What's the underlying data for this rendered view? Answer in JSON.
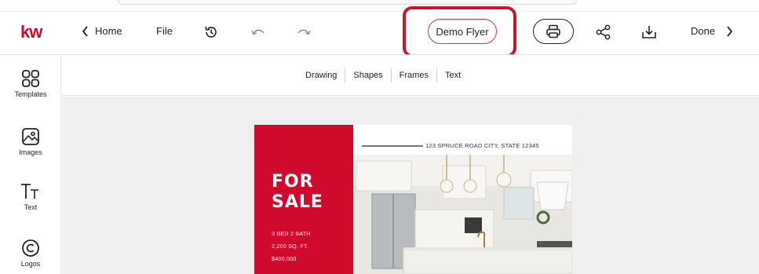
{
  "app": {
    "logo_text": "kw"
  },
  "toolbar": {
    "home_label": "Home",
    "file_label": "File",
    "document_name": "Demo Flyer",
    "done_label": "Done"
  },
  "subtabs": [
    "Drawing",
    "Shapes",
    "Frames",
    "Text"
  ],
  "sidebar": {
    "items": [
      {
        "label": "Templates",
        "icon": "templates-icon"
      },
      {
        "label": "Images",
        "icon": "images-icon"
      },
      {
        "label": "Text",
        "icon": "text-icon"
      },
      {
        "label": "Logos",
        "icon": "logos-icon"
      }
    ]
  },
  "flyer": {
    "headline_line1": "FOR",
    "headline_line2": "SALE",
    "spec_beds": "3 BED 2 BATH",
    "spec_area": "2,200 SQ. FT.",
    "spec_price": "$400,000",
    "address": "123 SPRUCE ROAD CITY, STATE 12345"
  },
  "colors": {
    "brand_red": "#cf0a2c",
    "highlight_red": "#c4182c",
    "canvas_bg": "#efefef"
  }
}
